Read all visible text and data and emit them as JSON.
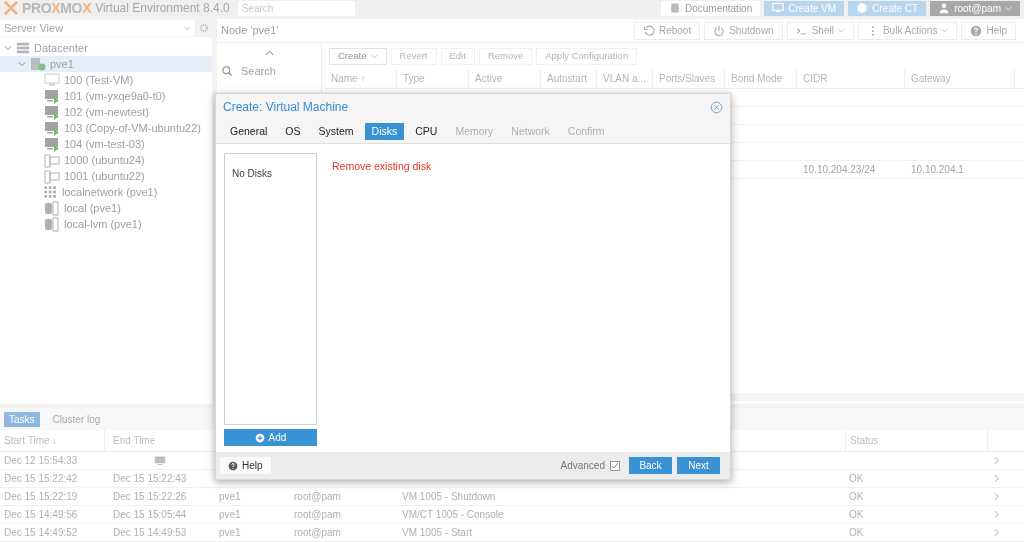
{
  "header": {
    "logo": [
      {
        "text": "PRO",
        "accent": false
      },
      {
        "text": "X",
        "accent": true
      },
      {
        "text": "MO",
        "accent": false
      },
      {
        "text": "X",
        "accent": true
      }
    ],
    "product": "Virtual Environment 8.4.0",
    "search": {
      "placeholder": "Search"
    },
    "buttons": [
      {
        "label": "Documentation",
        "kind": "docs"
      },
      {
        "label": "Create VM",
        "kind": "vm"
      },
      {
        "label": "Create CT",
        "kind": "ct"
      },
      {
        "label": "root@pam",
        "kind": "user"
      }
    ]
  },
  "sidebar": {
    "view": "Server View",
    "tree": [
      {
        "label": "Datacenter",
        "kind": "datacenter",
        "selected": false,
        "expanded": true,
        "children": [
          {
            "label": "pve1",
            "kind": "node",
            "selected": true,
            "expanded": true,
            "children": [
              {
                "label": "100 (Test-VM)",
                "kind": "vm-stopped",
                "selected": false
              },
              {
                "label": "101 (vm-yxqe9a0-t0)",
                "kind": "vm-running",
                "selected": false
              },
              {
                "label": "102 (vm-newtest)",
                "kind": "vm-running",
                "selected": false
              },
              {
                "label": "103 (Copy-of-VM-ubuntu22)",
                "kind": "vm-running",
                "selected": false
              },
              {
                "label": "104 (vm-test-03)",
                "kind": "vm-running",
                "selected": false
              },
              {
                "label": "1000 (ubuntu24)",
                "kind": "template",
                "selected": false
              },
              {
                "label": "1001 (ubuntu22)",
                "kind": "template",
                "selected": false
              },
              {
                "label": "localnetwork (pve1)",
                "kind": "network",
                "selected": false
              },
              {
                "label": "local (pve1)",
                "kind": "storage",
                "selected": false
              },
              {
                "label": "local-lvm (pve1)",
                "kind": "storage",
                "selected": false
              }
            ]
          }
        ]
      }
    ]
  },
  "node": {
    "title": "Node 'pve1'",
    "actions": [
      {
        "label": "Reboot",
        "kind": "reboot",
        "dropdown": false
      },
      {
        "label": "Shutdown",
        "kind": "power",
        "dropdown": false
      },
      {
        "label": "Shell",
        "kind": "shell",
        "dropdown": true
      },
      {
        "label": "Bulk Actions",
        "kind": "more",
        "dropdown": true
      },
      {
        "label": "Help",
        "kind": "help",
        "dropdown": false
      }
    ],
    "nav": [
      {
        "label": "Search",
        "kind": "search"
      }
    ],
    "toolbar": [
      {
        "label": "Create",
        "dropdown": true,
        "disabled": false
      },
      {
        "label": "Revert",
        "dropdown": false,
        "disabled": true
      },
      {
        "label": "Edit",
        "dropdown": false,
        "disabled": true
      },
      {
        "label": "Remove",
        "dropdown": false,
        "disabled": true
      },
      {
        "label": "Apply Configuration",
        "dropdown": false,
        "disabled": true
      }
    ],
    "columns": [
      "Name ↑",
      "Type",
      "Active",
      "Autostart",
      "VLAN a...",
      "Ports/Slaves",
      "Bond Mode",
      "CIDR",
      "Gateway"
    ],
    "rows": [
      {},
      {},
      {},
      {},
      {
        "cidr": "10.10.204.23/24",
        "gateway": "10.10.204.1"
      }
    ]
  },
  "dialog": {
    "title": "Create: Virtual Machine",
    "tabs": [
      {
        "label": "General",
        "selected": false,
        "disabled": false
      },
      {
        "label": "OS",
        "selected": false,
        "disabled": false
      },
      {
        "label": "System",
        "selected": false,
        "disabled": false
      },
      {
        "label": "Disks",
        "selected": true,
        "disabled": false
      },
      {
        "label": "CPU",
        "selected": false,
        "disabled": false
      },
      {
        "label": "Memory",
        "selected": false,
        "disabled": true
      },
      {
        "label": "Network",
        "selected": false,
        "disabled": true
      },
      {
        "label": "Confirm",
        "selected": false,
        "disabled": true
      }
    ],
    "empty_text": "No Disks",
    "message": "Remove existing disk",
    "add_button": "Add",
    "help_button": "Help",
    "advanced": {
      "label": "Advanced",
      "checked": true
    },
    "buttons": [
      "Back",
      "Next"
    ]
  },
  "tasks": {
    "tabs": [
      {
        "label": "Tasks",
        "selected": true
      },
      {
        "label": "Cluster log",
        "selected": false
      }
    ],
    "columns": {
      "start": "Start Time ↓",
      "end": "End Time",
      "status": "Status"
    },
    "rows": [
      {
        "start": "Dec 12 15:54:33",
        "running": true
      },
      {
        "start": "Dec 15 15:22:42",
        "end": "Dec 15 15:22:43",
        "status": "OK",
        "running": false
      },
      {
        "start": "Dec 15 15:22:19",
        "end": "Dec 15 15:22:26",
        "node": "pve1",
        "user": "root@pam",
        "description": "VM 1005 - Shutdown",
        "status": "OK",
        "running": false
      },
      {
        "start": "Dec 15 14:49:56",
        "end": "Dec 15 15:05:44",
        "node": "pve1",
        "user": "root@pam",
        "description": "VM/CT 1005 - Console",
        "status": "OK",
        "running": false
      },
      {
        "start": "Dec 15 14:49:52",
        "end": "Dec 15 14:49:53",
        "node": "pve1",
        "user": "root@pam",
        "description": "VM 1005 - Start",
        "status": "OK",
        "running": false
      }
    ]
  }
}
